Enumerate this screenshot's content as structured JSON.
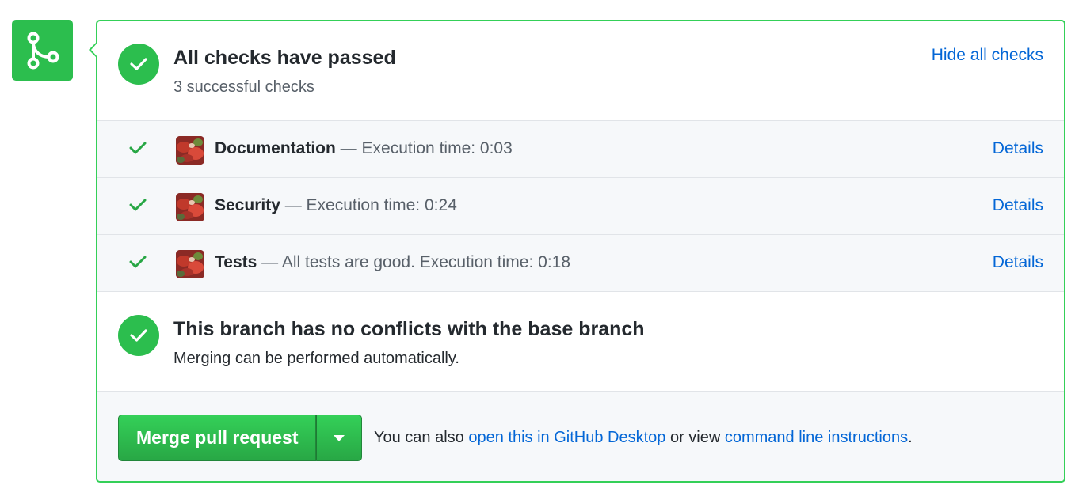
{
  "summary": {
    "title": "All checks have passed",
    "subtitle": "3 successful checks",
    "hide_link": "Hide all checks"
  },
  "checks": [
    {
      "name": "Documentation",
      "description": " — Execution time: 0:03",
      "details_label": "Details"
    },
    {
      "name": "Security",
      "description": " — Execution time: 0:24",
      "details_label": "Details"
    },
    {
      "name": "Tests",
      "description": " — All tests are good. Execution time: 0:18",
      "details_label": "Details"
    }
  ],
  "conflicts": {
    "title": "This branch has no conflicts with the base branch",
    "subtitle": "Merging can be performed automatically."
  },
  "merge": {
    "button_label": "Merge pull request",
    "note_prefix": "You can also ",
    "desktop_link": "open this in GitHub Desktop",
    "note_middle": " or view ",
    "cli_link": "command line instructions",
    "note_suffix": "."
  },
  "colors": {
    "success": "#2cbe4e",
    "border": "#34d058",
    "link": "#0366d6",
    "muted": "#586069"
  },
  "icons": {
    "badge": "git-merge-icon",
    "status": "check-icon",
    "dropdown": "triangle-down-icon"
  }
}
